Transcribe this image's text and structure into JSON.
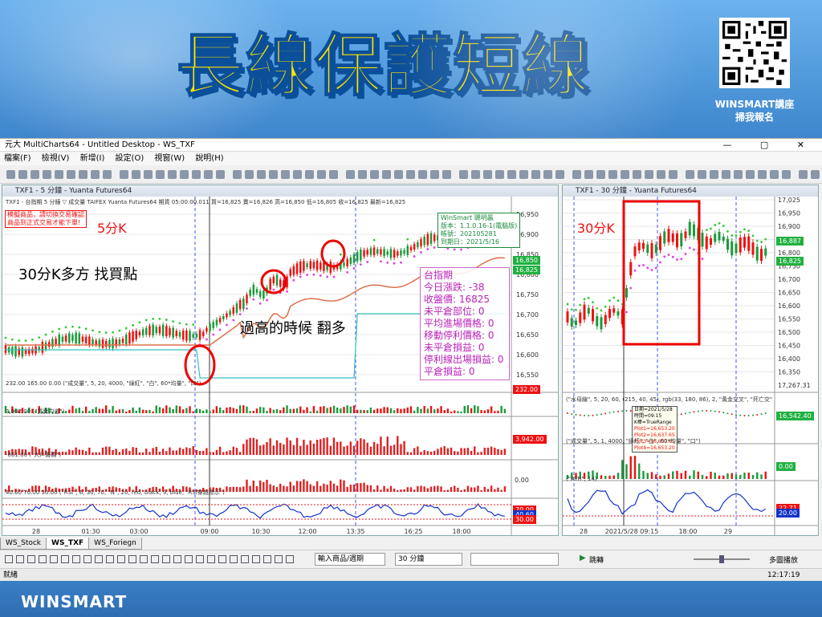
{
  "banner": {
    "headline": "長線保護短線",
    "qr_caption_1": "WINSMART講座",
    "qr_caption_2": "掃我報名"
  },
  "app": {
    "title": "元大 MultiCharts64 - Untitled Desktop - WS_TXF",
    "menu": [
      "檔案(F)",
      "檢視(V)",
      "新增(I)",
      "設定(O)",
      "視窗(W)",
      "說明(H)"
    ]
  },
  "left_chart": {
    "title": "TXF1 - 5 分鐘 - Yuanta Futures64",
    "quote_line": "TXF1 - 台指期 5 分鐘 ▽ 成交量 TAIFEX Yuanta Futures64 期貨 05:00:00.011 買=16,825 賣=16,826 高=16,850 低=16,805 收=16,825 最新=16,825",
    "warn_line_1": "模擬商品，請切換交易確認",
    "warn_line_2": "商品到正式交易才能下單!",
    "period_label": "5分K",
    "note_1": "30分K多方 找買點",
    "note_2": "過高的時候  翻多",
    "winsmart_box": [
      "WinSmart 聰明贏",
      "版本：1.1.0.16-1(電腦版)",
      "帳號：202105281",
      "到期日：2021/5/16"
    ],
    "info": {
      "title": "台指期",
      "rows": [
        "今日漲跌: -38",
        "收盤價: 16825",
        "未平倉部位: 0",
        "平均進場價格: 0",
        "移動停利價格: 0",
        "未平倉損益: 0",
        "停利線出場損益: 0",
        "平倉損益: 0"
      ]
    },
    "price_ticks": [
      "16,950",
      "16,900",
      "16,850",
      "16,800",
      "16,750",
      "16,700",
      "16,650",
      "16,600",
      "16,550"
    ],
    "price_tags": [
      "16,850",
      "16,825"
    ],
    "sub1_label": "232.00 165.00 0.00  (\"成交量\", 5, 20, 4000, \"綠紅\", \"白\", 60*均量\", \"口\")",
    "sub1_tag": "232.00",
    "sub2_label": "3,942.00  (\"買賣力道\")",
    "sub2_tag": "3,942.00",
    "sub3_label": "-861.00  (\"大戶籌碼\")",
    "sub3_tag": "0.00",
    "rsi_label": "40.60  70.00  30.00  (\"RSI\", 6, 30, 70, \"N\", 20, red, black, 9, blue, \"RSI穿越標示\")",
    "rsi_tags": [
      "70.00",
      "40.60",
      "30.00"
    ],
    "time_ticks": [
      "28",
      "01:30",
      "03:00",
      "09:00",
      "10:30",
      "12:00",
      "13:35",
      "16:25",
      "18:00"
    ]
  },
  "right_chart": {
    "title": "TXF1 - 30 分鐘 - Yuanta Futures64",
    "period_label": "30分K",
    "price_ticks": [
      "17,025",
      "16,950",
      "16,900",
      "16,850",
      "16,800",
      "16,750",
      "16,700",
      "16,650",
      "16,600",
      "16,550",
      "16,500",
      "16,450",
      "16,400",
      "16,350",
      "17,267.31"
    ],
    "price_tags": [
      "16,887",
      "16,825"
    ],
    "sub1_label": "(\"水母線\", 5, 20, 60, (215, 40, 45), rgb(33, 180, 86), 2, \"黃金交叉\", \"死亡交\"",
    "sub1_tag": "16,542.40",
    "tooltip": [
      "日期=2021/5/28",
      "時間=09:15",
      "K棒=TrueRange",
      "Plot1=16,653.20",
      "Plot2=16,637.65",
      "Plot3=16,637.65",
      "Plot4=16,653.20"
    ],
    "sub2_label": "(\"成交量\", 5, 1, 4000, \"綠紅\", \"白\", 60*均量\", \"口\")",
    "sub2_tag": "0.00",
    "sub3_label": "(\"ATR\", 14)",
    "sub3_tags": [
      "22.71",
      "20.00"
    ],
    "time_ticks": [
      "28",
      "2021/5/28 09:15",
      "18:00",
      "29"
    ]
  },
  "bottom": {
    "tabs": [
      "WS_Stock",
      "WS_TXF",
      "WS_Foriegn"
    ],
    "symbol_placeholder": "輸入商品/週期",
    "interval": "30 分鐘",
    "jump_label": "跳轉",
    "multi_label": "多圖播放",
    "status_left": "就緒",
    "clock": "12:17:19"
  },
  "footer": {
    "logo": "WINSMART"
  }
}
